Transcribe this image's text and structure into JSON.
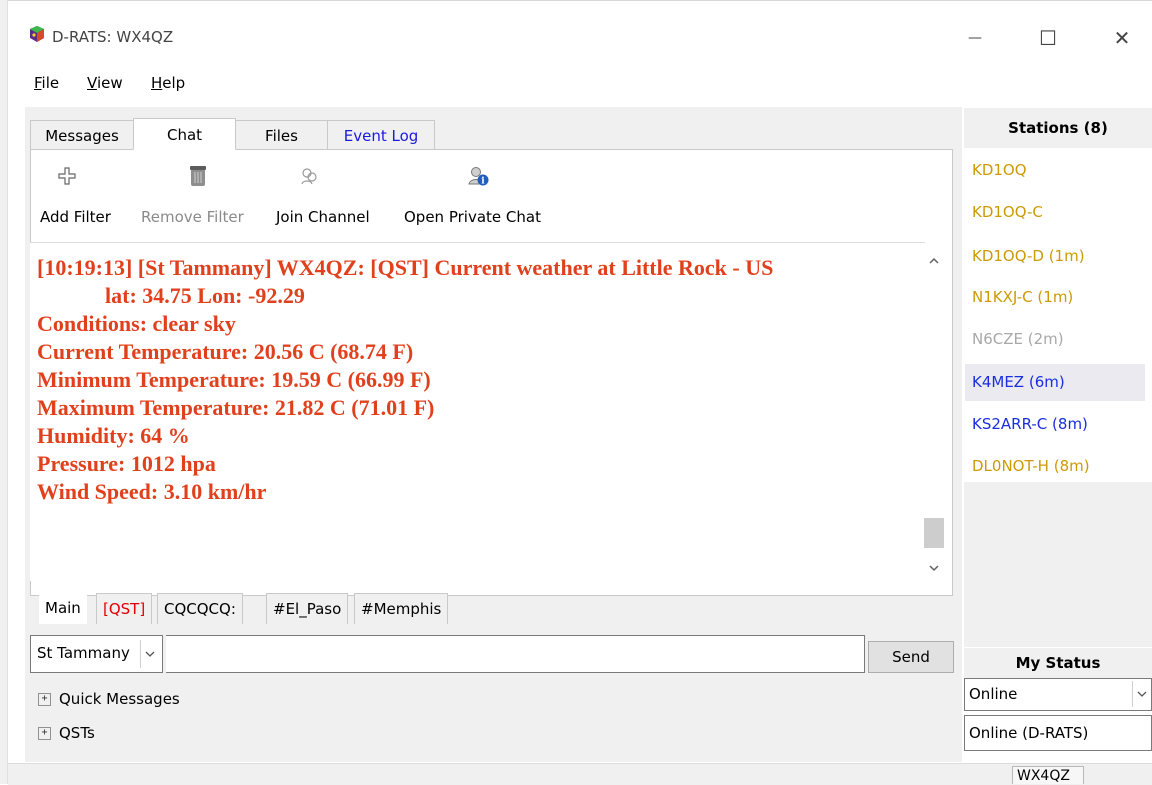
{
  "window": {
    "title": "D-RATS: WX4QZ",
    "minimize_glyph": "—",
    "maximize_glyph": "☐",
    "close_glyph": "✕"
  },
  "menu": {
    "file": "File",
    "view": "View",
    "help": "Help"
  },
  "tabs": {
    "messages": "Messages",
    "chat": "Chat",
    "files": "Files",
    "event_log": "Event Log",
    "event_log_color": "#1a1adf"
  },
  "toolbar": {
    "add_filter": "Add Filter",
    "remove_filter": "Remove Filter",
    "join_channel": "Join Channel",
    "open_private_chat": "Open Private Chat"
  },
  "chat": {
    "text_color": "#e0401c",
    "lines": [
      "[10:19:13] [St Tammany] WX4QZ: [QST] Current weather at Little Rock - US",
      "lat: 34.75 Lon: -92.29",
      "Conditions: clear sky",
      "Current Temperature: 20.56 C (68.74 F)",
      "Minimum Temperature: 19.59 C (66.99 F)",
      "Maximum Temperature: 21.82 C (71.01 F)",
      "Humidity: 64 %",
      "Pressure: 1012 hpa",
      "Wind Speed: 3.10 km/hr"
    ]
  },
  "channel_tabs": [
    "Main",
    "[QST]",
    "CQCQCQ:",
    "#El_Paso",
    "#Memphis"
  ],
  "channel_tab_qst_color": "#e00000",
  "input": {
    "channel": "St Tammany",
    "message": "",
    "send": "Send"
  },
  "tree": {
    "quick_messages": "Quick Messages",
    "qsts": "QSTs"
  },
  "stations": {
    "header": "Stations (8)",
    "items": [
      {
        "label": "KD1OQ",
        "color": "#cc9a06"
      },
      {
        "label": "KD1OQ-C",
        "color": "#cc9a06"
      },
      {
        "label": "KD1OQ-D (1m)",
        "color": "#cc9a06"
      },
      {
        "label": "N1KXJ-C (1m)",
        "color": "#cc9a06"
      },
      {
        "label": "N6CZE (2m)",
        "color": "#a8a8a8"
      },
      {
        "label": "K4MEZ (6m)",
        "color": "#1a2ee0"
      },
      {
        "label": "KS2ARR-C (8m)",
        "color": "#1a2ee0"
      },
      {
        "label": "DL0NOT-H (8m)",
        "color": "#cc9a06"
      }
    ]
  },
  "my_status": {
    "header": "My Status",
    "status": "Online",
    "message": "Online (D-RATS)"
  },
  "statusbar": {
    "callsign": "WX4QZ"
  }
}
